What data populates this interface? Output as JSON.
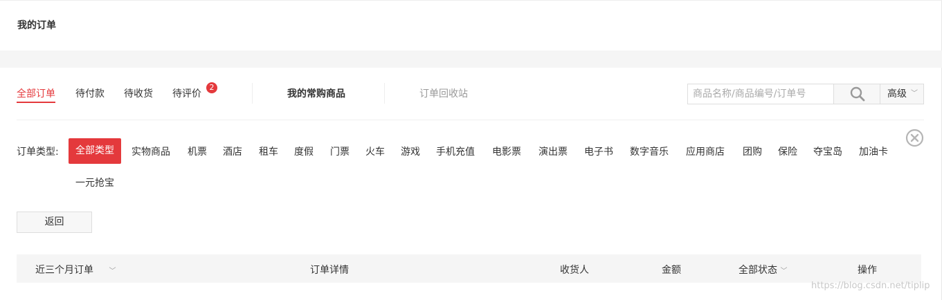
{
  "page_title": "我的订单",
  "tabs": [
    {
      "label": "全部订单"
    },
    {
      "label": "待付款"
    },
    {
      "label": "待收货"
    },
    {
      "label": "待评价",
      "badge": "2"
    }
  ],
  "frequent_goods": "我的常购商品",
  "recycle_bin": "订单回收站",
  "search": {
    "placeholder": "商品名称/商品编号/订单号",
    "advanced_label": "高级"
  },
  "order_types": {
    "label": "订单类型:",
    "items": [
      "全部类型",
      "实物商品",
      "机票",
      "酒店",
      "租车",
      "度假",
      "门票",
      "火车",
      "游戏",
      "手机充值",
      "电影票",
      "演出票",
      "电子书",
      "数字音乐",
      "应用商店",
      "团购",
      "保险",
      "夺宝岛",
      "加油卡",
      "一元抢宝"
    ]
  },
  "back_label": "返回",
  "table_header": {
    "period": "近三个月订单",
    "details": "订单详情",
    "receiver": "收货人",
    "amount": "金额",
    "status": "全部状态",
    "actions": "操作"
  },
  "watermark": "https://blog.csdn.net/tiplip",
  "colors": {
    "accent": "#e4393c",
    "band": "#f5f5f5",
    "border": "#dddddd"
  },
  "icons": {
    "search": "search-icon",
    "close": "close-circle-icon",
    "chevron": "chevron-down-icon"
  }
}
